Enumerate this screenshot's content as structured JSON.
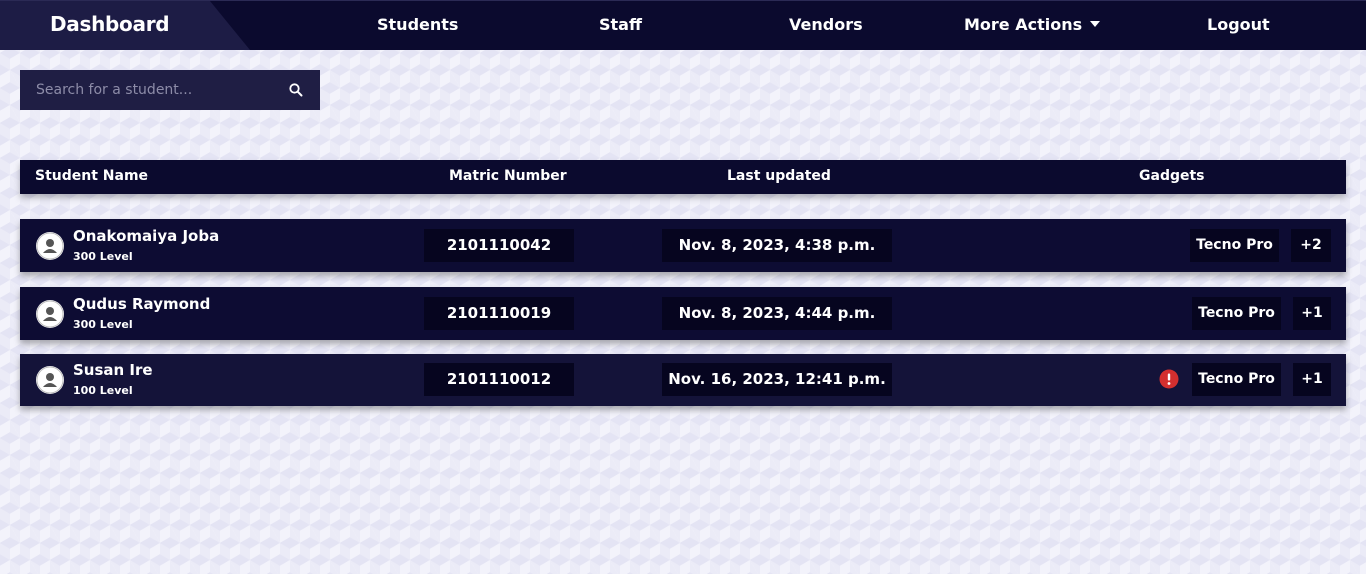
{
  "nav": {
    "brand": "Dashboard",
    "items": [
      "Students",
      "Staff",
      "Vendors",
      "More Actions",
      "Logout"
    ]
  },
  "search": {
    "placeholder": "Search for a student..."
  },
  "table": {
    "headers": [
      "Student Name",
      "Matric Number",
      "Last updated",
      "Gadgets"
    ],
    "rows": [
      {
        "name": "Onakomaiya Joba",
        "level": "300 Level",
        "matric": "2101110042",
        "updated": "Nov. 8, 2023, 4:38 p.m.",
        "gadget": "Tecno Pro",
        "extra": "+2",
        "alert": false
      },
      {
        "name": "Qudus Raymond",
        "level": "300 Level",
        "matric": "2101110019",
        "updated": "Nov. 8, 2023, 4:44 p.m.",
        "gadget": "Tecno Pro",
        "extra": "+1",
        "alert": false
      },
      {
        "name": "Susan Ire",
        "level": "100 Level",
        "matric": "2101110012",
        "updated": "Nov. 16, 2023, 12:41 p.m.",
        "gadget": "Tecno Pro",
        "extra": "+1",
        "alert": true
      }
    ]
  },
  "colors": {
    "navbar": "#0b0a2e",
    "brand_tab": "#1d1c45",
    "row": "#0d0c33",
    "cell": "#06051f",
    "alert": "#d32f2f"
  },
  "icons": {
    "search": "search-icon",
    "avatar": "user-avatar-icon",
    "alert": "alert-circle-icon",
    "dropdown": "caret-down-icon"
  }
}
